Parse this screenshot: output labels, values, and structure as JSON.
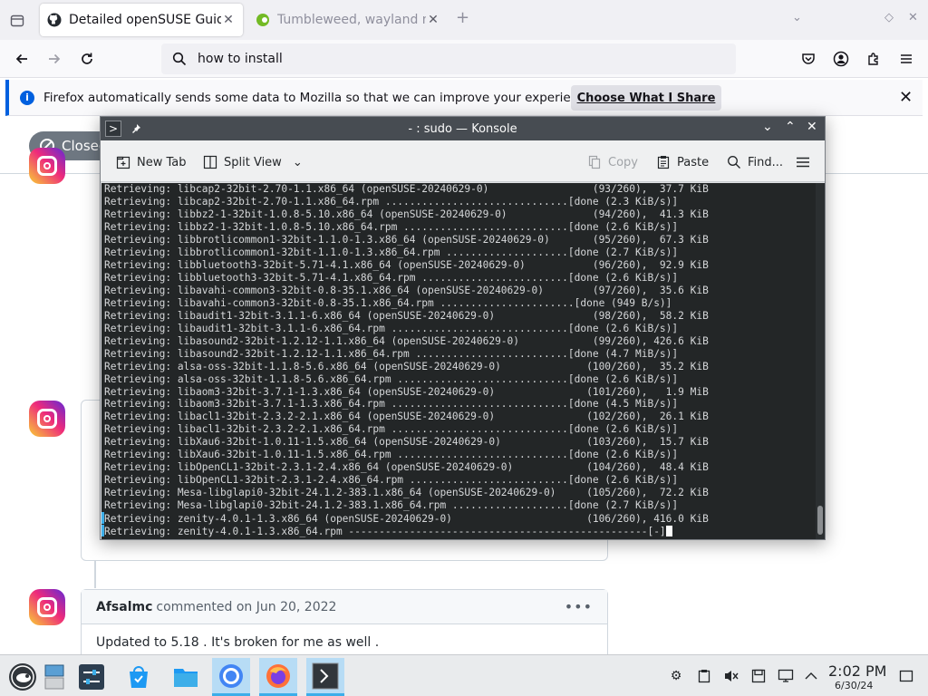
{
  "browser": {
    "tabs": [
      {
        "label": "Detailed openSUSE Guide",
        "active": true
      },
      {
        "label": "Tumbleweed, wayland not",
        "active": false
      }
    ],
    "url": "how to install",
    "notification": {
      "message": "Firefox automatically sends some data to Mozilla so that we can improve your experience.",
      "button": "Choose What I Share"
    }
  },
  "page": {
    "closed_badge": "Closed",
    "comment": {
      "author": "Afsalmc",
      "meta": "commented on Jun 20, 2022",
      "body": "Updated to 5.18 . It's broken for me as well ."
    }
  },
  "konsole": {
    "title": "- : sudo — Konsole",
    "toolbar": {
      "new_tab": "New Tab",
      "split_view": "Split View",
      "copy": "Copy",
      "paste": "Paste",
      "find": "Find..."
    },
    "lines": [
      "Retrieving: libcap2-32bit-2.70-1.1.x86_64 (openSUSE-20240629-0)                 (93/260),  37.7 KiB",
      "Retrieving: libcap2-32bit-2.70-1.1.x86_64.rpm ..............................[done (2.3 KiB/s)]",
      "Retrieving: libbz2-1-32bit-1.0.8-5.10.x86_64 (openSUSE-20240629-0)              (94/260),  41.3 KiB",
      "Retrieving: libbz2-1-32bit-1.0.8-5.10.x86_64.rpm ...........................[done (2.6 KiB/s)]",
      "Retrieving: libbrotlicommon1-32bit-1.1.0-1.3.x86_64 (openSUSE-20240629-0)       (95/260),  67.3 KiB",
      "Retrieving: libbrotlicommon1-32bit-1.1.0-1.3.x86_64.rpm ....................[done (2.7 KiB/s)]",
      "Retrieving: libbluetooth3-32bit-5.71-4.1.x86_64 (openSUSE-20240629-0)           (96/260),  92.9 KiB",
      "Retrieving: libbluetooth3-32bit-5.71-4.1.x86_64.rpm ........................[done (2.6 KiB/s)]",
      "Retrieving: libavahi-common3-32bit-0.8-35.1.x86_64 (openSUSE-20240629-0)        (97/260),  35.6 KiB",
      "Retrieving: libavahi-common3-32bit-0.8-35.1.x86_64.rpm ......................[done (949 B/s)]",
      "Retrieving: libaudit1-32bit-3.1.1-6.x86_64 (openSUSE-20240629-0)                (98/260),  58.2 KiB",
      "Retrieving: libaudit1-32bit-3.1.1-6.x86_64.rpm .............................[done (2.6 KiB/s)]",
      "Retrieving: libasound2-32bit-1.2.12-1.1.x86_64 (openSUSE-20240629-0)            (99/260), 426.6 KiB",
      "Retrieving: libasound2-32bit-1.2.12-1.1.x86_64.rpm .........................[done (4.7 MiB/s)]",
      "Retrieving: alsa-oss-32bit-1.1.8-5.6.x86_64 (openSUSE-20240629-0)              (100/260),  35.2 KiB",
      "Retrieving: alsa-oss-32bit-1.1.8-5.6.x86_64.rpm ............................[done (2.6 KiB/s)]",
      "Retrieving: libaom3-32bit-3.7.1-1.3.x86_64 (openSUSE-20240629-0)               (101/260),   1.9 MiB",
      "Retrieving: libaom3-32bit-3.7.1-1.3.x86_64.rpm .............................[done (4.5 MiB/s)]",
      "Retrieving: libacl1-32bit-2.3.2-2.1.x86_64 (openSUSE-20240629-0)               (102/260),  26.1 KiB",
      "Retrieving: libacl1-32bit-2.3.2-2.1.x86_64.rpm .............................[done (2.6 KiB/s)]",
      "Retrieving: libXau6-32bit-1.0.11-1.5.x86_64 (openSUSE-20240629-0)              (103/260),  15.7 KiB",
      "Retrieving: libXau6-32bit-1.0.11-1.5.x86_64.rpm ............................[done (2.6 KiB/s)]",
      "Retrieving: libOpenCL1-32bit-2.3.1-2.4.x86_64 (openSUSE-20240629-0)            (104/260),  48.4 KiB",
      "Retrieving: libOpenCL1-32bit-2.3.1-2.4.x86_64.rpm ..........................[done (2.6 KiB/s)]",
      "Retrieving: Mesa-libglapi0-32bit-24.1.2-383.1.x86_64 (openSUSE-20240629-0)     (105/260),  72.2 KiB",
      "Retrieving: Mesa-libglapi0-32bit-24.1.2-383.1.x86_64.rpm ...................[done (2.7 KiB/s)]",
      "Retrieving: zenity-4.0.1-1.3.x86_64 (openSUSE-20240629-0)                      (106/260), 416.0 KiB",
      "Retrieving: zenity-4.0.1-1.3.x86_64.rpm -------------------------------------------------[-]"
    ]
  },
  "taskbar": {
    "time": "2:02 PM",
    "date": "6/30/24"
  },
  "colors": {
    "terminal_bg": "#232627",
    "terminal_fg": "#d5d7d9",
    "konsole_titlebar": "#474c52",
    "accent": "#3daee9",
    "firefox_blue": "#0060df"
  }
}
